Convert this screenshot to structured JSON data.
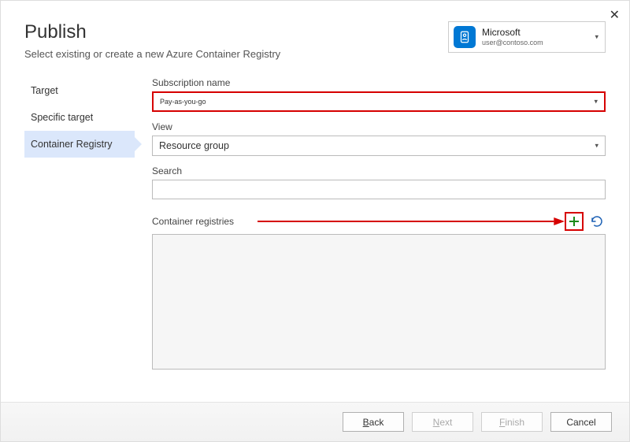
{
  "header": {
    "title": "Publish",
    "subtitle": "Select existing or create a new Azure Container Registry"
  },
  "account": {
    "name": "Microsoft",
    "email": "user@contoso.com"
  },
  "sidebar": {
    "items": [
      {
        "label": "Target",
        "selected": false
      },
      {
        "label": "Specific target",
        "selected": false
      },
      {
        "label": "Container Registry",
        "selected": true
      }
    ]
  },
  "form": {
    "subscription": {
      "label": "Subscription name",
      "value": "Pay-as-you-go"
    },
    "view": {
      "label": "View",
      "value": "Resource group"
    },
    "search": {
      "label": "Search",
      "value": ""
    },
    "registries_label": "Container registries"
  },
  "footer": {
    "back": "Back",
    "next": "Next",
    "finish": "Finish",
    "cancel": "Cancel"
  }
}
